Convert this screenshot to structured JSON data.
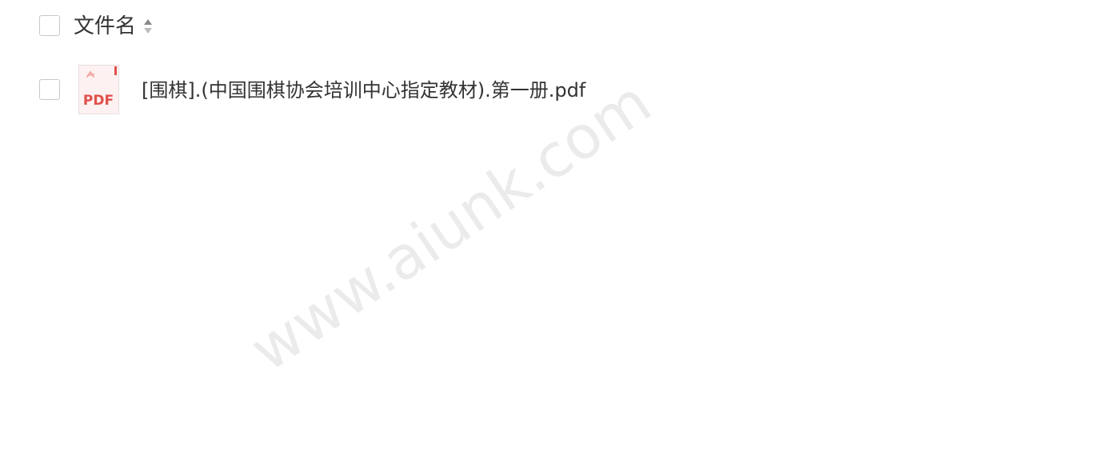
{
  "table": {
    "header": {
      "column_label": "文件名",
      "sort_icon": "sort-icon"
    },
    "rows": [
      {
        "file_type_icon": "pdf-icon",
        "file_icon_text": "PDF",
        "name": "[围棋].(中国围棋协会培训中心指定教材).第一册.pdf"
      }
    ]
  },
  "watermark": {
    "text": "www.aiunk.com"
  },
  "colors": {
    "text": "#333333",
    "checkbox_border": "#c8c8c8",
    "pdf_red": "#e0504b",
    "watermark": "#ebebeb"
  }
}
